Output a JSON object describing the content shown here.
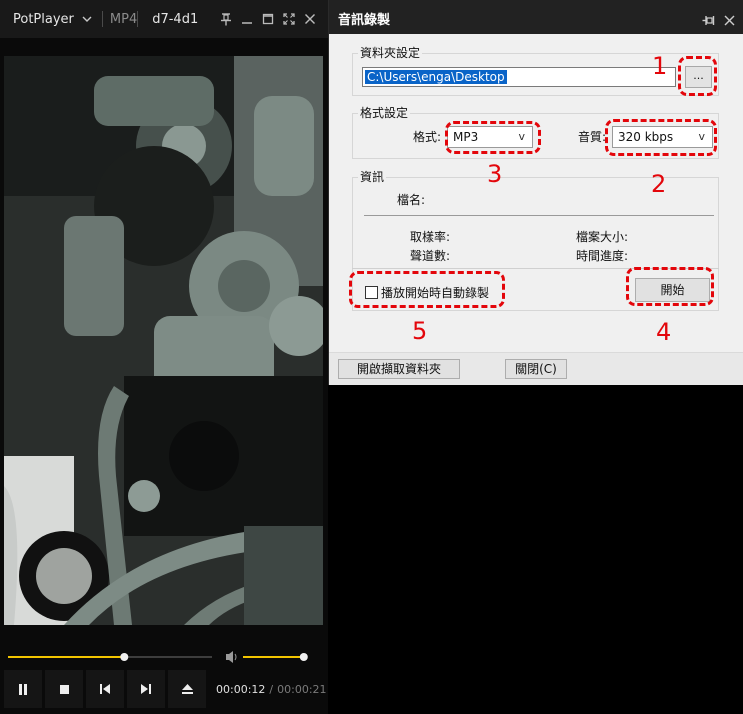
{
  "player": {
    "app_name": "PotPlayer",
    "format": "MP4",
    "title": "d7-4d1",
    "time_current": "00:00:12",
    "time_separator": "/",
    "time_total": "00:00:21",
    "seek_progress": 0.57,
    "volume_level": 0.95,
    "icons": [
      "chevron-down-icon",
      "pin-icon",
      "minimize-icon",
      "maximize-icon",
      "fullscreen-icon",
      "close-icon",
      "speaker-icon",
      "pause-icon",
      "stop-icon",
      "previous-icon",
      "next-icon",
      "eject-icon"
    ]
  },
  "dialog": {
    "title": "音訊錄製",
    "folder_group_label": "資料夾設定",
    "folder_path": "C:\\Users\\enga\\Desktop",
    "browse_label": "...",
    "format_group_label": "格式設定",
    "format_label": "格式:",
    "format_value": "MP3",
    "quality_label": "音質:",
    "quality_value": "320 kbps",
    "dropdown_arrow": "v",
    "info_group_label": "資訊",
    "filename_label": "檔名:",
    "sample_rate_label": "取樣率:",
    "channels_label": "聲道數:",
    "file_size_label": "檔案大小:",
    "time_progress_label": "時間進度:",
    "auto_record_label": "播放開始時自動錄製",
    "auto_record_checked": false,
    "start_button": "開始",
    "open_folder_button": "開啟擷取資料夾",
    "close_button": "關閉(C)"
  },
  "annotations": {
    "color": "#e3060b",
    "numbers": [
      "1",
      "2",
      "3",
      "4",
      "5"
    ]
  },
  "colors": {
    "player_bg": "#0a0a0a",
    "accent_yellow": "#f2c500",
    "selection_blue": "#0a64c8"
  }
}
